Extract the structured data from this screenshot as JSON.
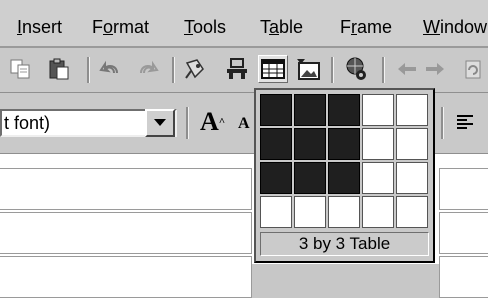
{
  "menubar": {
    "items": [
      {
        "pre": "",
        "ul": "I",
        "post": "nsert"
      },
      {
        "pre": "F",
        "ul": "o",
        "post": "rmat"
      },
      {
        "pre": "",
        "ul": "T",
        "post": "ools"
      },
      {
        "pre": "T",
        "ul": "a",
        "post": "ble"
      },
      {
        "pre": "F",
        "ul": "r",
        "post": "ame"
      },
      {
        "pre": "",
        "ul": "W",
        "post": "indow"
      }
    ]
  },
  "toolbar2": {
    "font_value": "t font)",
    "grow_font_glyph": "A",
    "shrink_font_glyph": "A"
  },
  "table_picker": {
    "label": "3 by 3 Table",
    "rows": 4,
    "cols": 5,
    "selected_rows": 3,
    "selected_cols": 3
  },
  "colors": {
    "menubar_bg": "#cfcfcf",
    "toolbar_bg": "#c9c9c9",
    "grid_selected": "#1f1f1f",
    "grid_empty": "#ffffff"
  }
}
